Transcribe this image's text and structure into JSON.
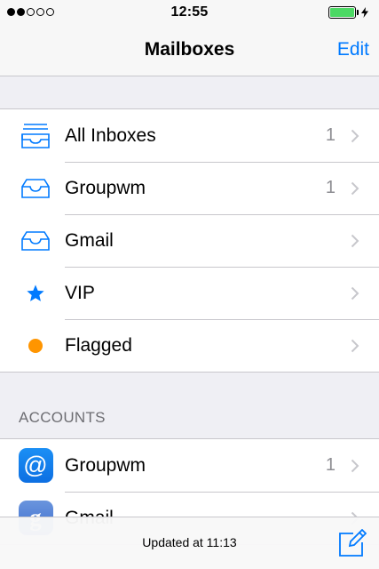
{
  "status_bar": {
    "time": "12:55",
    "signal_filled": 2,
    "signal_total": 5,
    "battery_level": 1.0,
    "battery_color": "#4cd964"
  },
  "nav": {
    "title": "Mailboxes",
    "edit_label": "Edit"
  },
  "mailboxes": [
    {
      "label": "All Inboxes",
      "count": "1",
      "icon": "tray-stack-icon"
    },
    {
      "label": "Groupwm",
      "count": "1",
      "icon": "tray-icon"
    },
    {
      "label": "Gmail",
      "count": "",
      "icon": "tray-icon"
    },
    {
      "label": "VIP",
      "count": "",
      "icon": "star-icon"
    },
    {
      "label": "Flagged",
      "count": "",
      "icon": "orange-dot-icon"
    }
  ],
  "accounts_header": "ACCOUNTS",
  "accounts": [
    {
      "label": "Groupwm",
      "count": "1",
      "icon": "at-sign-app-icon",
      "glyph": "@"
    },
    {
      "label": "Gmail",
      "count": "",
      "icon": "google-app-icon",
      "glyph": "g"
    }
  ],
  "toolbar": {
    "status": "Updated at 11:13",
    "compose_icon": "compose-icon"
  },
  "colors": {
    "accent": "#007aff",
    "flag": "#ff9500",
    "background": "#efeff4"
  }
}
